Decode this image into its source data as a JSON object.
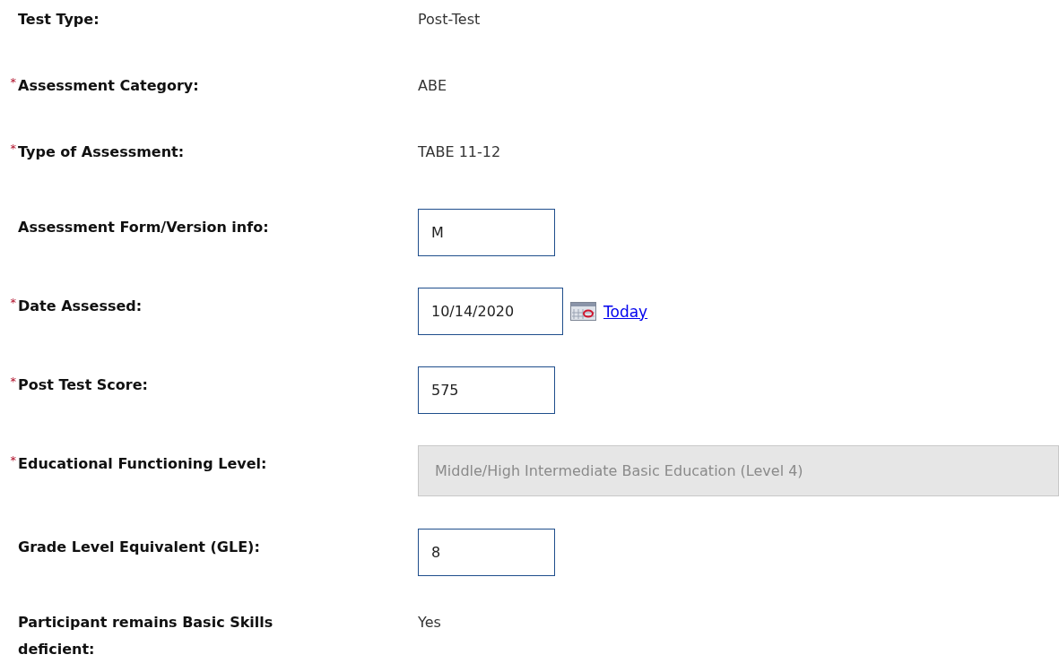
{
  "fields": [
    {
      "kind": "text",
      "label": "Test Type:",
      "value": "Post-Test"
    },
    {
      "kind": "text",
      "required_mark": "*",
      "label": "Assessment Category:",
      "value": "ABE"
    },
    {
      "kind": "text",
      "required_mark": "*",
      "label": "Type of Assessment:",
      "value": "TABE 11-12"
    },
    {
      "kind": "input",
      "label": "Assessment Form/Version info:",
      "value": "M"
    },
    {
      "kind": "date",
      "required_mark": "*",
      "label": "Date Assessed:",
      "value": "10/14/2020",
      "link": "Today"
    },
    {
      "kind": "input",
      "required_mark": "*",
      "label": "Post Test Score:",
      "value": "575"
    },
    {
      "kind": "disabled",
      "required_mark": "*",
      "label": "Educational Functioning Level:",
      "value": "Middle/High Intermediate Basic Education (Level 4)"
    },
    {
      "kind": "input",
      "label": "Grade Level Equivalent (GLE):",
      "value": "8"
    },
    {
      "kind": "text",
      "label": "Participant remains Basic Skills deficient:",
      "value": "Yes"
    }
  ]
}
